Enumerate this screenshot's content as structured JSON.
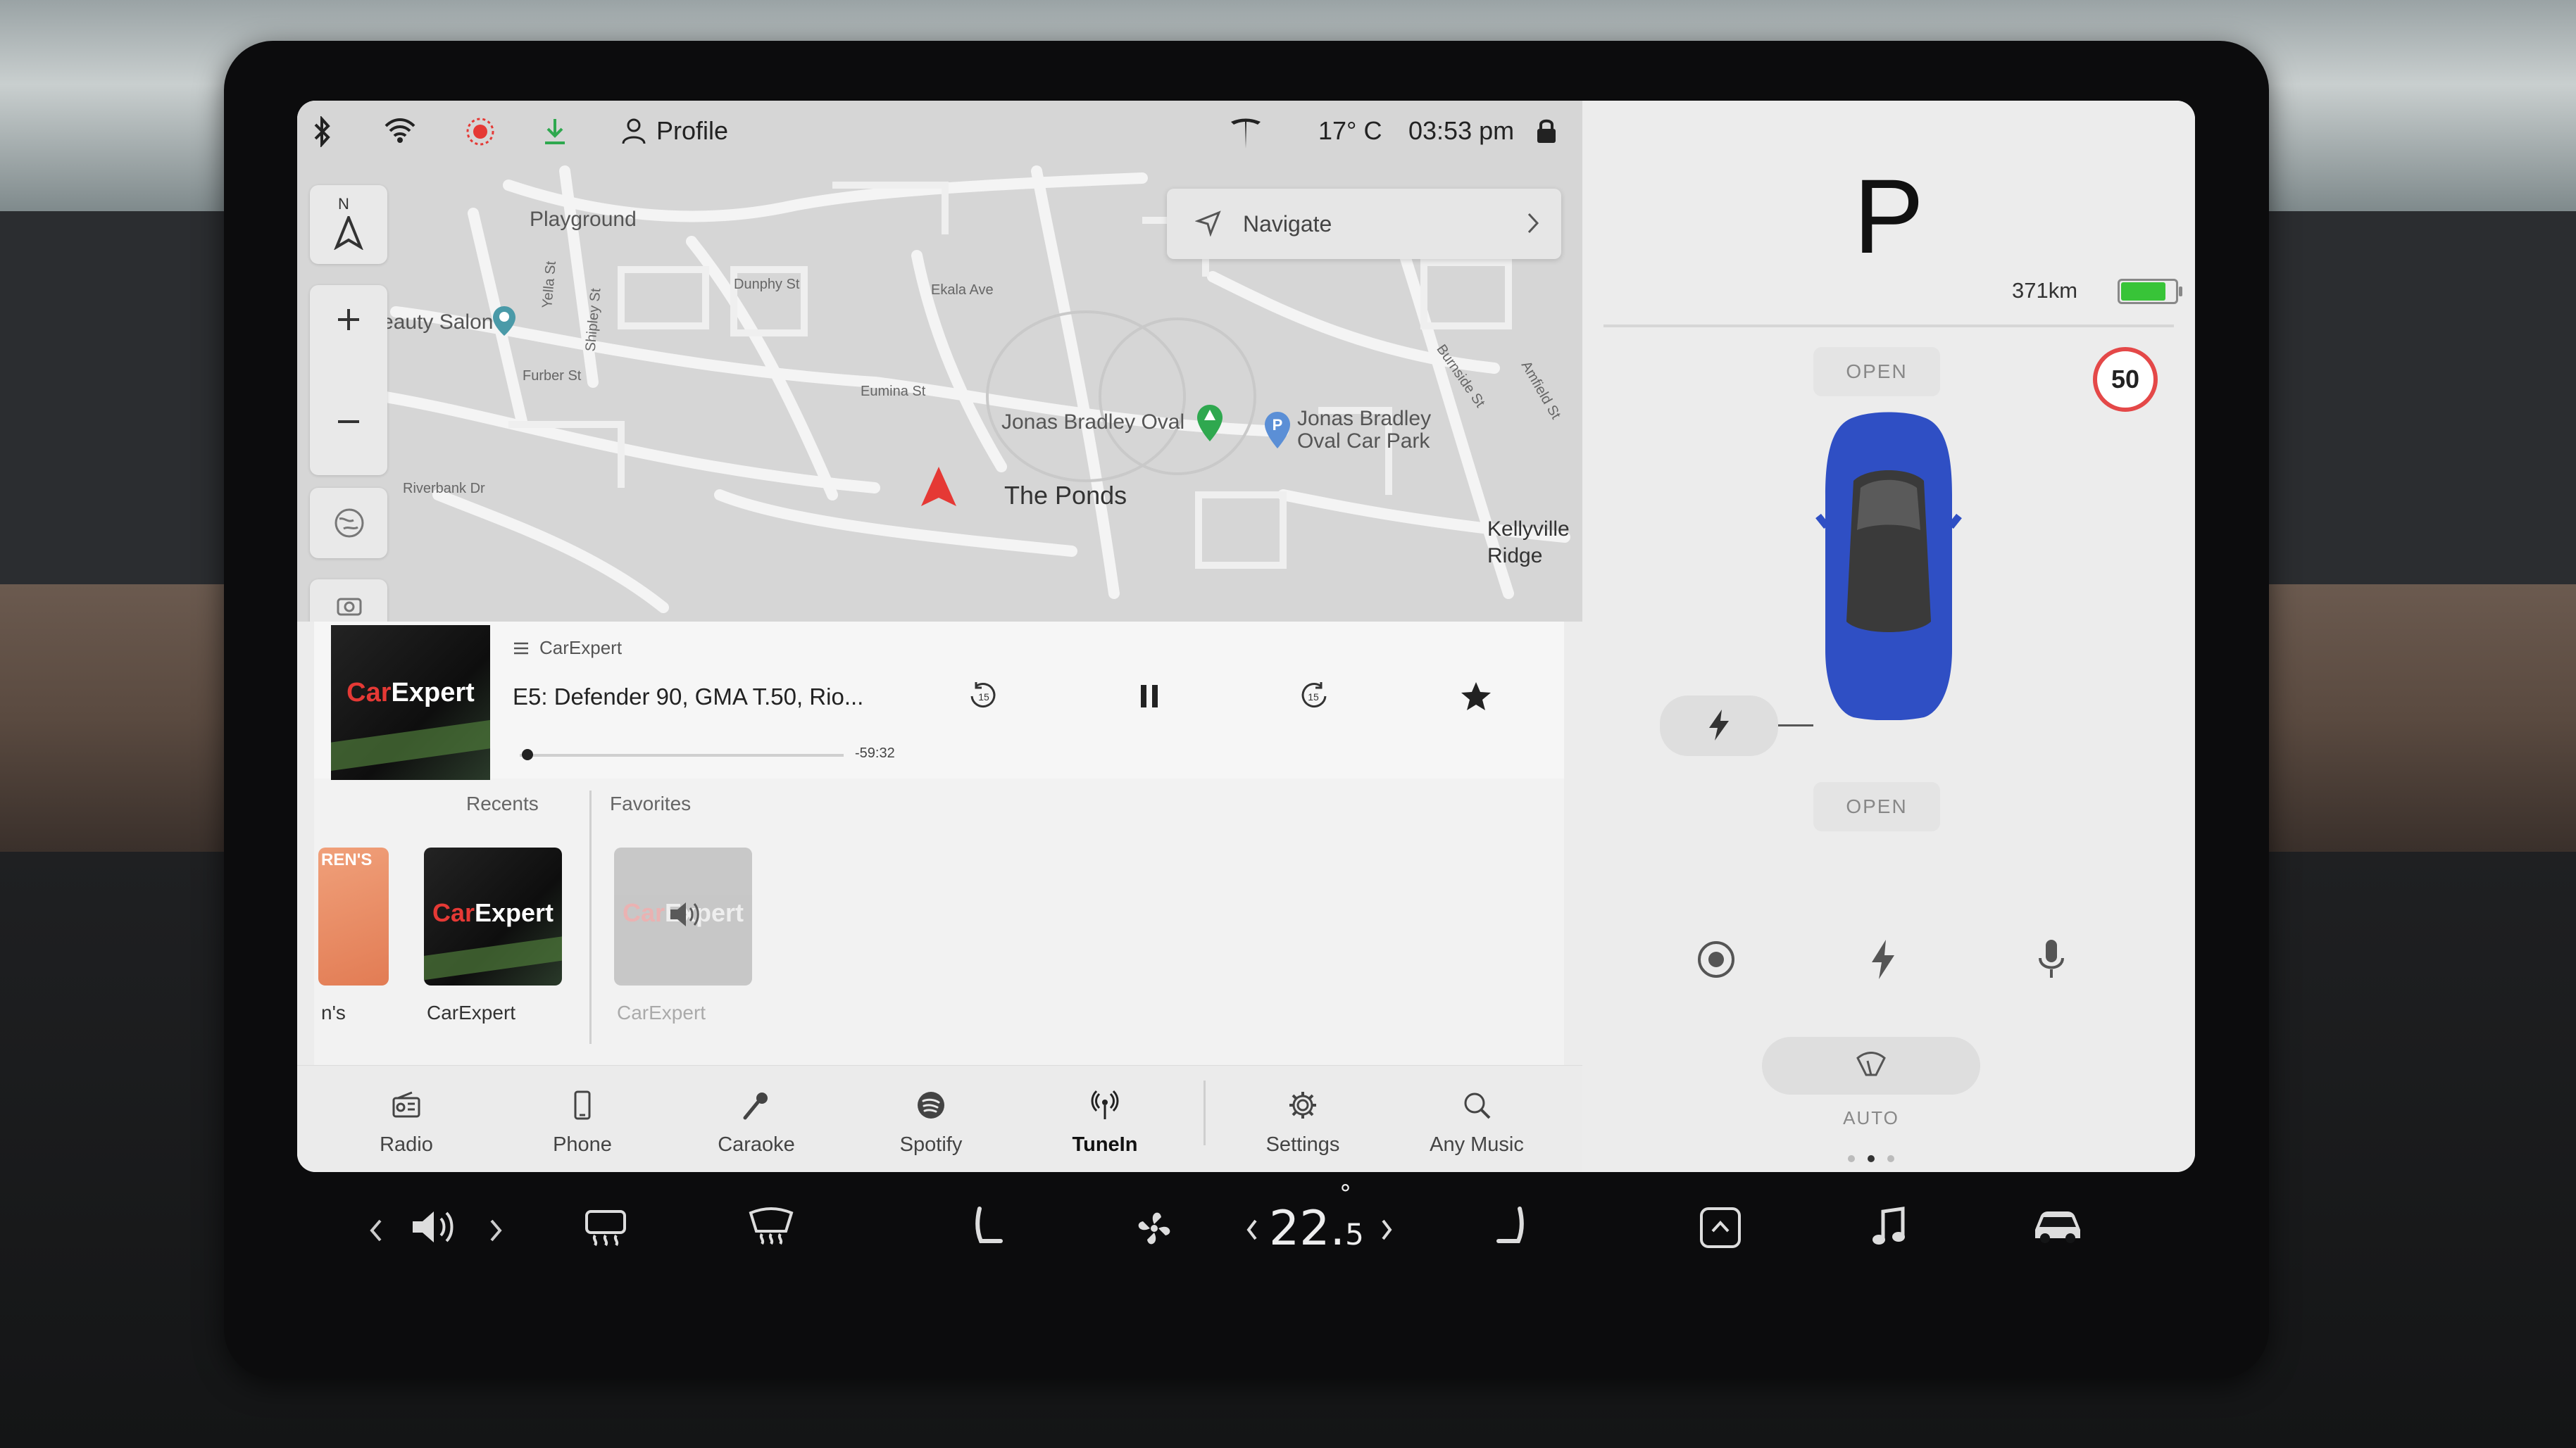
{
  "status_bar": {
    "profile_label": "Profile",
    "temperature": "17° C",
    "time": "03:53 pm"
  },
  "map": {
    "navigate_label": "Navigate",
    "compass_label": "N",
    "labels": {
      "playground": "Playground",
      "beauty_salon": "Beauty Salon",
      "dunphy_st": "Dunphy St",
      "ekala_ave": "Ekala Ave",
      "furber_st": "Furber St",
      "eumina_st": "Eumina St",
      "jonas_bradley_oval": "Jonas Bradley Oval",
      "jonas_bradley_car_park": "Jonas Bradley Oval Car Park",
      "the_ponds": "The Ponds",
      "kellyville_ridge": "Kellyville Ridge",
      "riverbank_dr": "Riverbank Dr",
      "burnside_st": "Burnside St",
      "amfield_st": "Amfield St",
      "shipley_st": "Shipley St",
      "yella_st": "Yella St"
    }
  },
  "media": {
    "source": "CarExpert",
    "track_title": "E5: Defender 90, GMA T.50, Rio...",
    "remaining": "-59:32",
    "progress": 0.02,
    "album_logo": {
      "prefix": "Car",
      "suffix": "Expert"
    },
    "tabs": {
      "recents": "Recents",
      "favorites": "Favorites"
    },
    "recents": [
      {
        "caption": "n's",
        "tile_text": "REN'S"
      },
      {
        "caption": "CarExpert"
      }
    ],
    "favorites": [
      {
        "caption": "CarExpert"
      }
    ]
  },
  "apps": [
    {
      "label": "Radio",
      "icon": "radio-icon"
    },
    {
      "label": "Phone",
      "icon": "phone-icon"
    },
    {
      "label": "Caraoke",
      "icon": "microphone-icon"
    },
    {
      "label": "Spotify",
      "icon": "spotify-icon"
    },
    {
      "label": "TuneIn",
      "icon": "tunein-icon",
      "active": true
    },
    {
      "label": "Settings",
      "icon": "gear-icon"
    },
    {
      "label": "Any Music",
      "icon": "search-icon"
    }
  ],
  "car": {
    "gear": "P",
    "range": "371km",
    "battery_level": 0.85,
    "frunk_label": "OPEN",
    "trunk_label": "OPEN",
    "speed_limit": "50",
    "wiper_mode": "AUTO",
    "car_color": "#2f4fc4"
  },
  "climate": {
    "temp_whole": "22.",
    "temp_decimal": "5",
    "temp_degree": "°"
  },
  "colors": {
    "accent_red": "#e53935",
    "battery_green": "#38c438",
    "speed_limit_ring": "#e44848"
  }
}
